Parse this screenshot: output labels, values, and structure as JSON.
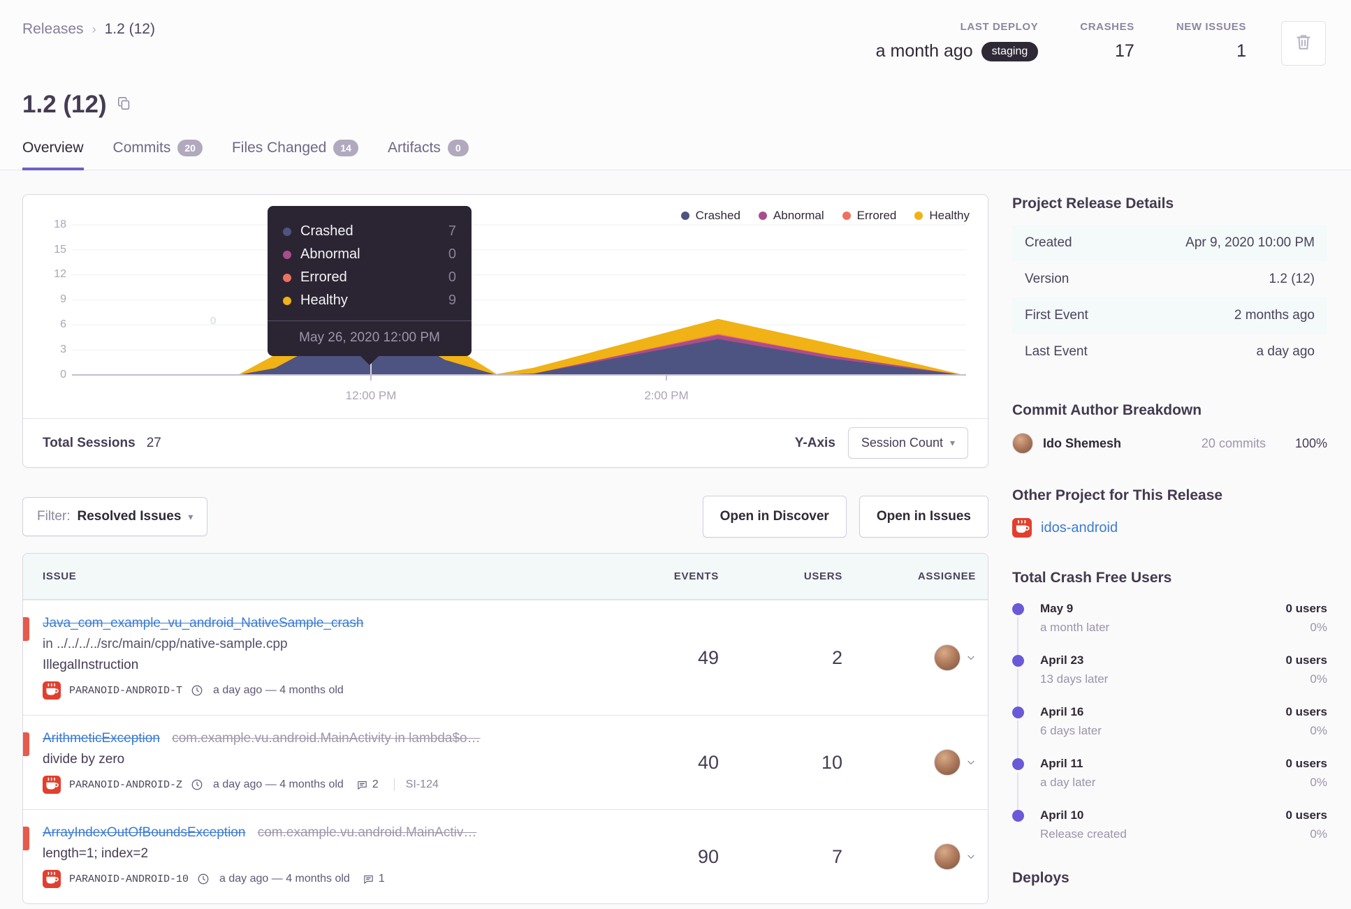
{
  "breadcrumb": {
    "parent": "Releases",
    "current": "1.2 (12)"
  },
  "header": {
    "last_deploy_label": "LAST DEPLOY",
    "last_deploy_value": "a month ago",
    "env_badge": "staging",
    "crashes_label": "CRASHES",
    "crashes_value": "17",
    "new_issues_label": "NEW ISSUES",
    "new_issues_value": "1"
  },
  "title": {
    "text": "1.2 (12)"
  },
  "tabs": [
    {
      "label": "Overview"
    },
    {
      "label": "Commits",
      "badge": "20"
    },
    {
      "label": "Files Changed",
      "badge": "14"
    },
    {
      "label": "Artifacts",
      "badge": "0"
    }
  ],
  "chart_data": {
    "type": "area",
    "stacked": true,
    "xlim": [
      10,
      16
    ],
    "ylim": [
      0,
      18
    ],
    "x_hours": [
      10,
      11.1,
      11.35,
      12,
      12.5,
      12.85,
      13.1,
      14.35,
      15.1,
      16
    ],
    "series": [
      {
        "name": "Crashed",
        "color": "#4e5481",
        "values": [
          0,
          0,
          0.8,
          7,
          1.8,
          0,
          0.15,
          4.3,
          2,
          0
        ]
      },
      {
        "name": "Abnormal",
        "color": "#aa4d8c",
        "values": [
          0,
          0,
          0,
          0,
          0,
          0,
          0,
          0.5,
          0.35,
          0
        ]
      },
      {
        "name": "Errored",
        "color": "#ee7060",
        "values": [
          0,
          0,
          0,
          0,
          0,
          0,
          0,
          0.12,
          0.05,
          0
        ]
      },
      {
        "name": "Healthy",
        "color": "#f0b215",
        "values": [
          0,
          0,
          1.6,
          2.5,
          2.2,
          0.1,
          0.7,
          1.8,
          1.4,
          0.05
        ]
      }
    ],
    "y_ticks": [
      18,
      15,
      12,
      9,
      6,
      3,
      0
    ],
    "x_tick_labels": [
      {
        "label": "12:00 PM"
      },
      {
        "label": "2:00 PM"
      }
    ],
    "legend": [
      "Crashed",
      "Abnormal",
      "Errored",
      "Healthy"
    ],
    "legend_position": "top-right",
    "grid": "horizontal",
    "ghost_label": "0",
    "tooltip": {
      "rows": [
        {
          "label": "Crashed",
          "value": "7"
        },
        {
          "label": "Abnormal",
          "value": "0"
        },
        {
          "label": "Errored",
          "value": "0"
        },
        {
          "label": "Healthy",
          "value": "9"
        }
      ],
      "date": "May 26, 2020 12:00 PM"
    },
    "total_sessions": "27",
    "yaxis_selected": "Session Count"
  },
  "chart_footer": {
    "total_label": "Total Sessions",
    "total_value": "27",
    "yaxis_label": "Y-Axis",
    "yaxis_value": "Session Count"
  },
  "filter_bar": {
    "filter_label": "Filter:",
    "filter_value": "Resolved Issues",
    "discover_button": "Open in Discover",
    "issues_button": "Open in Issues"
  },
  "issues": {
    "columns": [
      "ISSUE",
      "EVENTS",
      "USERS",
      "ASSIGNEE"
    ],
    "rows": [
      {
        "title": "Java_com_example_vu_android_NativeSample_crash",
        "culprit": "in ../../../../src/main/cpp/native-sample.cpp",
        "message": "IllegalInstruction",
        "project": "PARANOID-ANDROID-T",
        "age": "a day ago — 4 months old",
        "events": "49",
        "users": "2"
      },
      {
        "title": "ArithmeticException",
        "subtitle": "com.example.vu.android.MainActivity in lambda$o…",
        "message": "divide by zero",
        "project": "PARANOID-ANDROID-Z",
        "age": "a day ago — 4 months old",
        "comments": "2",
        "ticket": "SI-124",
        "events": "40",
        "users": "10"
      },
      {
        "title": "ArrayIndexOutOfBoundsException",
        "subtitle": "com.example.vu.android.MainActiv…",
        "message": "length=1; index=2",
        "project": "PARANOID-ANDROID-10",
        "age": "a day ago — 4 months old",
        "comments": "1",
        "events": "90",
        "users": "7"
      }
    ]
  },
  "sidebar": {
    "details": {
      "heading": "Project Release Details",
      "rows": [
        {
          "label": "Created",
          "value": "Apr 9, 2020 10:00 PM"
        },
        {
          "label": "Version",
          "value": "1.2 (12)"
        },
        {
          "label": "First Event",
          "value": "2 months ago"
        },
        {
          "label": "Last Event",
          "value": "a day ago"
        }
      ]
    },
    "authors": {
      "heading": "Commit Author Breakdown",
      "name": "Ido Shemesh",
      "commits": "20 commits",
      "percent": "100%"
    },
    "other_project": {
      "heading": "Other Project for This Release",
      "link": "idos-android"
    },
    "crash_free": {
      "heading": "Total Crash Free Users",
      "items": [
        {
          "date": "May 9",
          "sub": "a month later",
          "users": "0 users",
          "percent": "0%"
        },
        {
          "date": "April 23",
          "sub": "13 days later",
          "users": "0 users",
          "percent": "0%"
        },
        {
          "date": "April 16",
          "sub": "6 days later",
          "users": "0 users",
          "percent": "0%"
        },
        {
          "date": "April 11",
          "sub": "a day later",
          "users": "0 users",
          "percent": "0%"
        },
        {
          "date": "April 10",
          "sub": "Release created",
          "users": "0 users",
          "percent": "0%"
        }
      ]
    },
    "deploys_heading": "Deploys"
  }
}
